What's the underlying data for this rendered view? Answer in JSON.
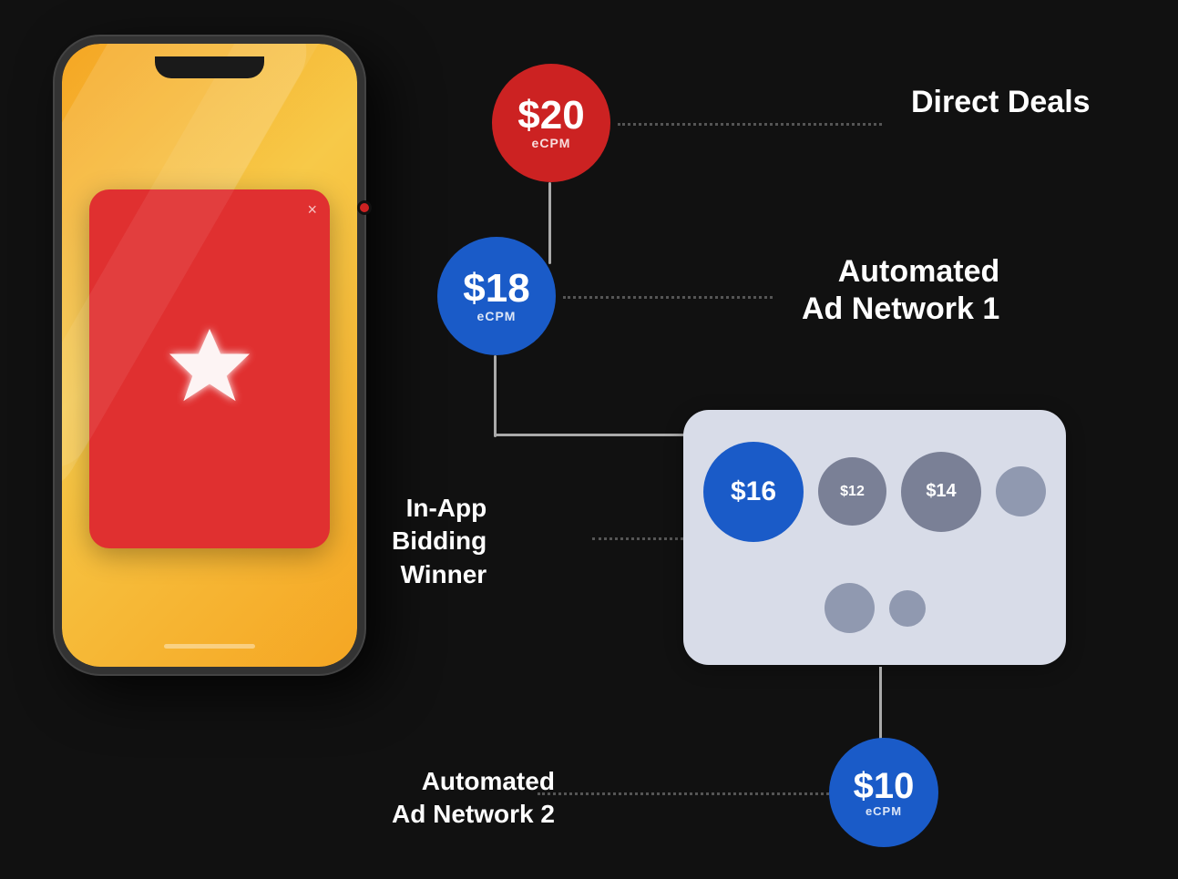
{
  "phone": {
    "alt": "Mobile phone"
  },
  "diagram": {
    "bubble20": {
      "amount": "$20",
      "ecpm": "eCPM"
    },
    "bubble18": {
      "amount": "$18",
      "ecpm": "eCPM"
    },
    "bubble10": {
      "amount": "$10",
      "ecpm": "eCPM"
    },
    "biddingBubbles": [
      {
        "value": "$16",
        "size": "large"
      },
      {
        "value": "$12",
        "size": "medium"
      },
      {
        "value": "$14",
        "size": "medium-2"
      },
      {
        "value": "",
        "size": "small"
      },
      {
        "value": "",
        "size": "small"
      },
      {
        "value": "",
        "size": "tiny"
      }
    ],
    "labelDirectDeals": "Direct Deals",
    "labelAdNetwork1Line1": "Automated",
    "labelAdNetwork1Line2": "Ad Network 1",
    "labelBiddingLine1": "In-App",
    "labelBiddingLine2": "Bidding",
    "labelBiddingLine3": "Winner",
    "labelAdNetwork2Line1": "Automated",
    "labelAdNetwork2Line2": "Ad Network 2"
  }
}
